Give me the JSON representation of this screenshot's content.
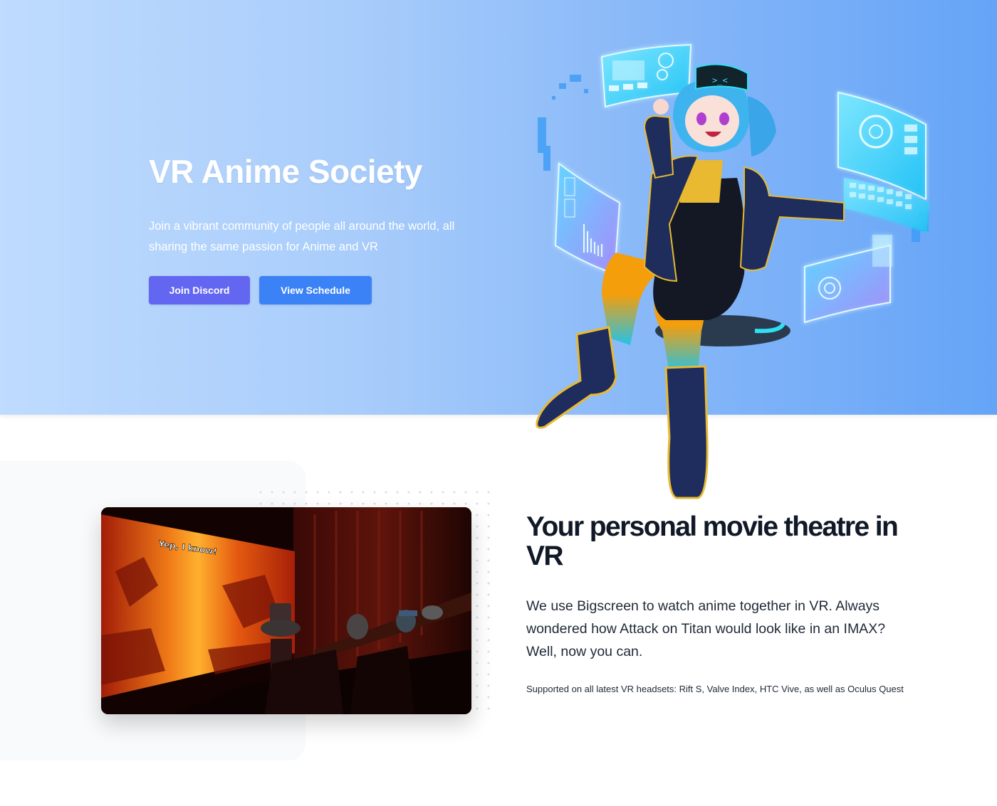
{
  "hero": {
    "title": "VR Anime Society",
    "description": "Join a vibrant community of people all around the world, all sharing the same passion for Anime and VR",
    "buttons": {
      "join_discord": "Join Discord",
      "view_schedule": "View Schedule"
    },
    "illustration": "anime-girl-vr-headset-illustration",
    "colors": {
      "join_discord": "#6366f1",
      "view_schedule": "#3b82f6"
    }
  },
  "feature": {
    "image": "bigscreen-vr-theatre-screenshot",
    "image_subtitle": "Yep, I know!",
    "title": "Your personal movie theatre in VR",
    "description": "We use Bigscreen to watch anime together in VR. Always wondered how Attack on Titan would look like in an IMAX? Well, now you can.",
    "note": "Supported on all latest VR headsets: Rift S, Valve Index, HTC Vive, as well as Oculus Quest"
  }
}
